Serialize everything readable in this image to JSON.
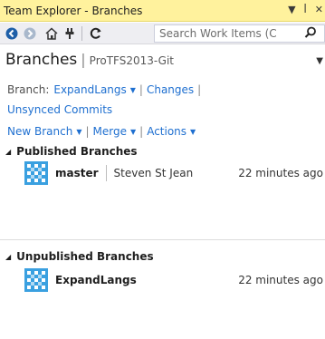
{
  "window": {
    "title": "Team Explorer - Branches",
    "title_bg": "#fff29d"
  },
  "toolbar": {
    "icons": [
      "back-icon",
      "forward-icon",
      "home-icon",
      "connect-icon",
      "refresh-icon"
    ],
    "search_placeholder": "Search Work Items (C"
  },
  "header": {
    "title": "Branches",
    "separator": "|",
    "project": "ProTFS2013-Git"
  },
  "branch_row": {
    "label": "Branch:",
    "current": "ExpandLangs",
    "changes": "Changes",
    "unsynced": "Unsynced Commits"
  },
  "actions": {
    "new_branch": "New Branch",
    "merge": "Merge",
    "actions": "Actions"
  },
  "published": {
    "heading": "Published Branches",
    "items": [
      {
        "name": "master",
        "author": "Steven St Jean",
        "time": "22 minutes ago"
      }
    ]
  },
  "unpublished": {
    "heading": "Unpublished Branches",
    "items": [
      {
        "name": "ExpandLangs",
        "time": "22 minutes ago"
      }
    ]
  },
  "colors": {
    "link": "#1e6fd0",
    "branch_icon": "#3aa0e0"
  }
}
